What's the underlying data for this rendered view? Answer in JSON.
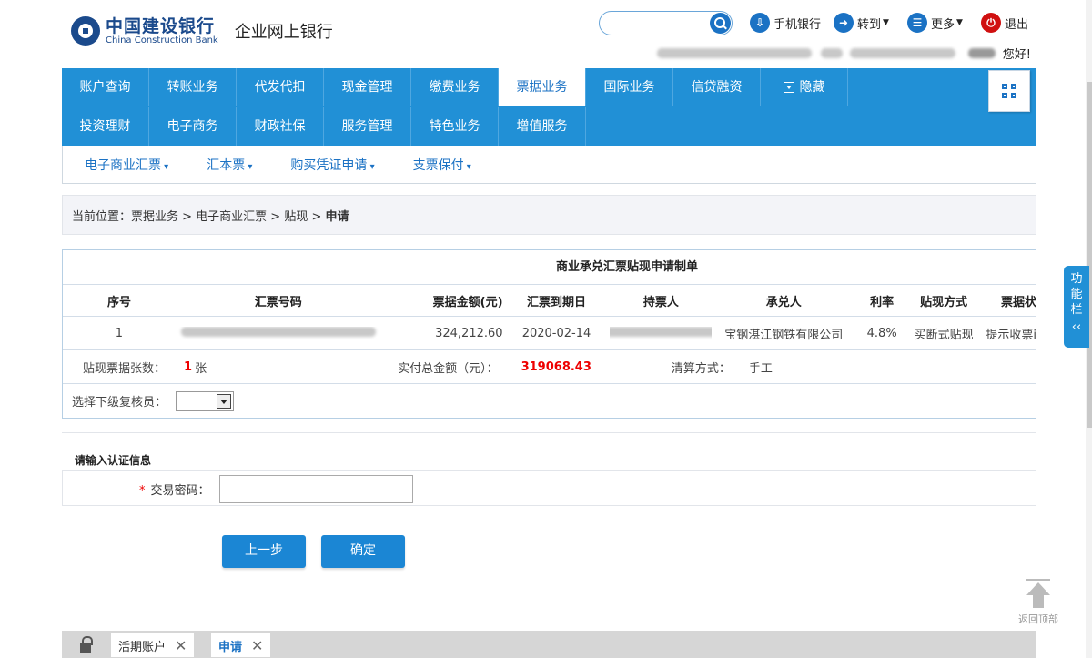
{
  "header": {
    "bank_name_cn": "中国建设银行",
    "bank_name_en": "China Construction Bank",
    "product": "企业网上银行",
    "search_placeholder": "",
    "links": [
      {
        "label": "手机银行",
        "icon": "mobile-download-icon"
      },
      {
        "label": "转到",
        "icon": "share-arrow-icon"
      },
      {
        "label": "更多",
        "icon": "list-icon"
      },
      {
        "label": "退出",
        "icon": "power-icon"
      }
    ],
    "greeting": "您好!"
  },
  "nav": {
    "row1": [
      "账户查询",
      "转账业务",
      "代发代扣",
      "现金管理",
      "缴费业务",
      "票据业务",
      "国际业务",
      "信贷融资",
      "隐藏"
    ],
    "row2": [
      "投资理财",
      "电子商务",
      "财政社保",
      "服务管理",
      "特色业务",
      "增值服务"
    ],
    "active": "票据业务"
  },
  "subnav": [
    "电子商业汇票",
    "汇本票",
    "购买凭证申请",
    "支票保付"
  ],
  "breadcrumb": {
    "prefix": "当前位置：",
    "path": "票据业务 > 电子商业汇票 > 贴现 > ",
    "current": "申请"
  },
  "form_title": "商业承兑汇票贴现申请制单",
  "table": {
    "headers": [
      "序号",
      "汇票号码",
      "票据金额(元)",
      "汇票到期日",
      "持票人",
      "承兑人",
      "利率",
      "贴现方式",
      "票据状"
    ],
    "rows": [
      {
        "index": "1",
        "bill_no": "",
        "amount": "324,212.60",
        "due_date": "2020-02-14",
        "holder": "",
        "acceptor": "宝钢湛江钢铁有限公司",
        "rate": "4.8%",
        "method": "买断式贴现",
        "status": "提示收票i"
      }
    ]
  },
  "summary": {
    "count_label": "贴现票据张数：",
    "count_value": "1",
    "count_unit": "张",
    "total_label": "实付总金额（元）：",
    "total_value": "319068.43",
    "settle_label": "清算方式：",
    "settle_value": "手工"
  },
  "reviewer": {
    "label": "选择下级复核员：",
    "value": ""
  },
  "auth": {
    "title": "请输入认证信息",
    "required_mark": "*",
    "password_label": "交易密码：",
    "password_value": ""
  },
  "buttons": {
    "prev": "上一步",
    "confirm": "确定"
  },
  "side_tab": "功能栏",
  "side_tab_icon": "double-chevron-left-icon",
  "back_to_top": "返回顶部",
  "bottom_tabs": [
    {
      "label": "活期账户",
      "active": false
    },
    {
      "label": "申请",
      "active": true
    }
  ],
  "colors": {
    "primary": "#2190d6",
    "accent": "#1b72c4",
    "highlight": "#e00000"
  }
}
